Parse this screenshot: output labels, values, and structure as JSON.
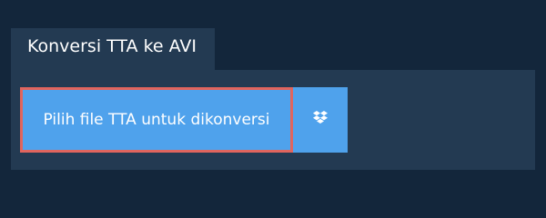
{
  "converter": {
    "tab_title": "Konversi TTA ke AVI",
    "choose_file_label": "Pilih file TTA untuk dikonversi",
    "dropbox_icon": "dropbox-icon"
  },
  "colors": {
    "page_background": "#13263b",
    "panel_background": "#233a52",
    "button_blue": "#4fa2ec",
    "focus_border": "#e0655e",
    "text": "#ffffff"
  }
}
